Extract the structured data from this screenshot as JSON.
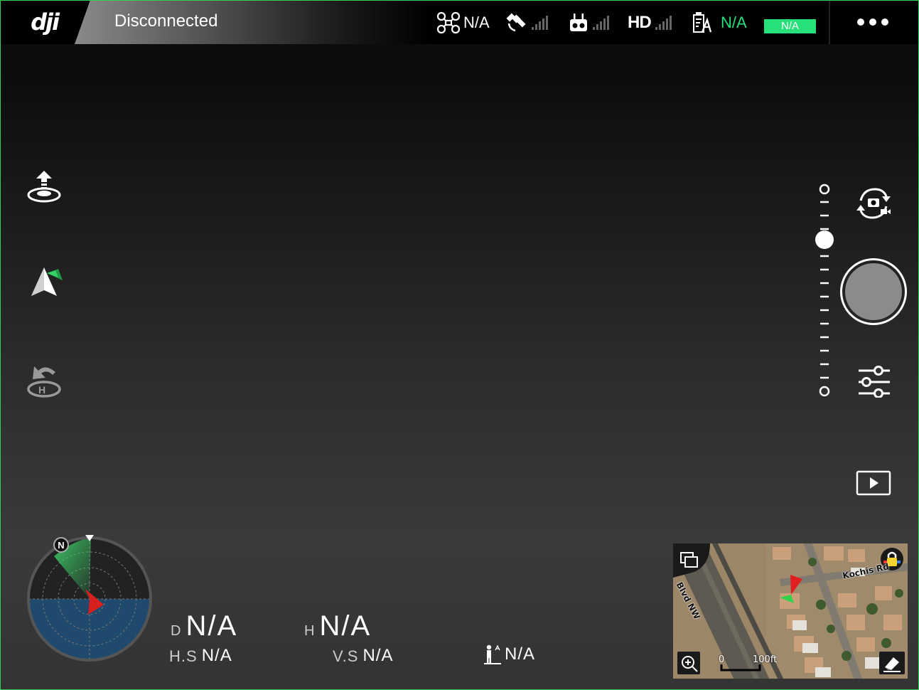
{
  "topbar": {
    "logo": "dji",
    "status": "Disconnected",
    "aircraft_value": "N/A",
    "hd_label": "HD",
    "battery_value": "N/A",
    "battery_bar_label": "N/A",
    "colors": {
      "accent_green": "#27e07a",
      "background": "#000000"
    }
  },
  "telemetry": {
    "distance": {
      "label": "D",
      "value": "N/A"
    },
    "height": {
      "label": "H",
      "value": "N/A"
    },
    "horizontal_speed": {
      "label": "H.S",
      "value": "N/A"
    },
    "vertical_speed": {
      "label": "V.S",
      "value": "N/A"
    },
    "vps_height": {
      "value": "N/A"
    }
  },
  "radar": {
    "north_label": "N"
  },
  "map": {
    "road_1": "Blvd NW",
    "road_2": "Kochis Rd",
    "scale_zero": "0",
    "scale_label": "100ft"
  },
  "icons": {
    "left": [
      "auto-takeoff-icon",
      "navigation-icon",
      "return-home-icon"
    ],
    "right": [
      "camera-video-switch-icon",
      "shutter-button",
      "camera-settings-icon",
      "playback-icon"
    ]
  }
}
